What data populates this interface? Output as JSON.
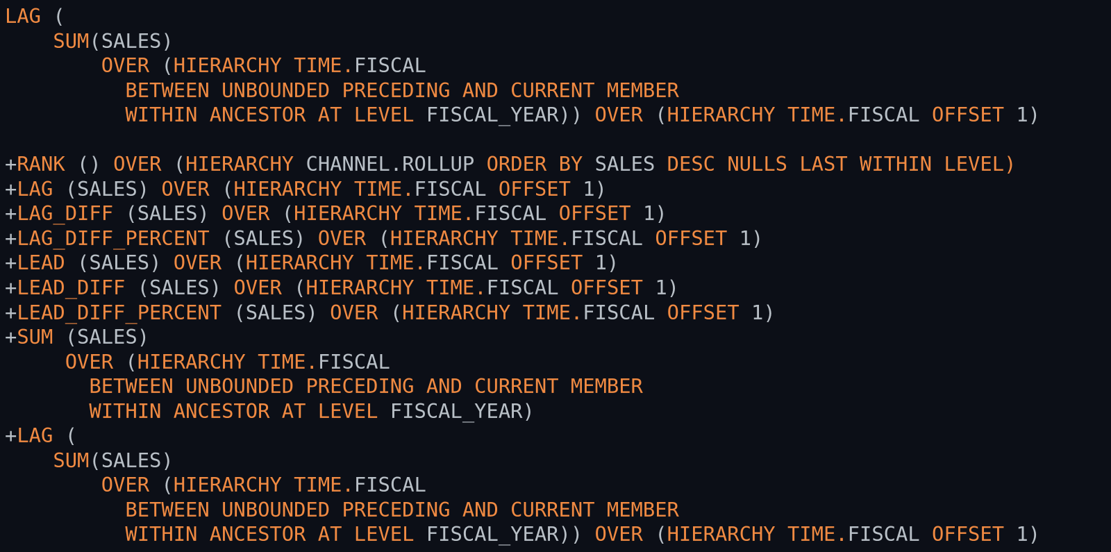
{
  "editor": {
    "name": "sql-analytic-view-expression-viewer",
    "background_color": "#0c0f17",
    "keyword_color": "#f08a42",
    "identifier_color": "#b9c0c7",
    "font_size_px": 28.8,
    "line_height_px": 35.55,
    "total_lines": 22
  },
  "lines": [
    {
      "id": 1,
      "text": "LAG (",
      "tokens": [
        {
          "t": "LAG",
          "c": "kw"
        },
        {
          "t": " ",
          "c": "punc"
        },
        {
          "t": "(",
          "c": "punc"
        }
      ]
    },
    {
      "id": 2,
      "text": "    SUM(SALES)",
      "tokens": [
        {
          "t": "    ",
          "c": "punc"
        },
        {
          "t": "SUM",
          "c": "kw"
        },
        {
          "t": "(SALES)",
          "c": "ident"
        }
      ]
    },
    {
      "id": 3,
      "text": "        OVER (HIERARCHY TIME.FISCAL",
      "tokens": [
        {
          "t": "        ",
          "c": "punc"
        },
        {
          "t": "OVER",
          "c": "kw"
        },
        {
          "t": " ",
          "c": "punc"
        },
        {
          "t": "(",
          "c": "punc"
        },
        {
          "t": "HIERARCHY",
          "c": "kw"
        },
        {
          "t": " ",
          "c": "punc"
        },
        {
          "t": "TIME",
          "c": "kw"
        },
        {
          "t": ".",
          "c": "kw"
        },
        {
          "t": "FISCAL",
          "c": "ident"
        }
      ]
    },
    {
      "id": 4,
      "text": "          BETWEEN UNBOUNDED PRECEDING AND CURRENT MEMBER",
      "tokens": [
        {
          "t": "          ",
          "c": "punc"
        },
        {
          "t": "BETWEEN UNBOUNDED PRECEDING AND CURRENT MEMBER",
          "c": "kw"
        }
      ]
    },
    {
      "id": 5,
      "text": "          WITHIN ANCESTOR AT LEVEL FISCAL_YEAR)) OVER (HIERARCHY TIME.FISCAL OFFSET 1)",
      "tokens": [
        {
          "t": "          ",
          "c": "punc"
        },
        {
          "t": "WITHIN ANCESTOR AT LEVEL",
          "c": "kw"
        },
        {
          "t": " FISCAL_YEAR)) ",
          "c": "ident"
        },
        {
          "t": "OVER",
          "c": "kw"
        },
        {
          "t": " ",
          "c": "punc"
        },
        {
          "t": "(",
          "c": "punc"
        },
        {
          "t": "HIERARCHY",
          "c": "kw"
        },
        {
          "t": " ",
          "c": "punc"
        },
        {
          "t": "TIME",
          "c": "kw"
        },
        {
          "t": ".",
          "c": "kw"
        },
        {
          "t": "FISCAL",
          "c": "ident"
        },
        {
          "t": " ",
          "c": "punc"
        },
        {
          "t": "OFFSET",
          "c": "kw"
        },
        {
          "t": " 1)",
          "c": "ident"
        }
      ]
    },
    {
      "id": 6,
      "text": "",
      "tokens": []
    },
    {
      "id": 7,
      "text": "+RANK () OVER (HIERARCHY CHANNEL.ROLLUP ORDER BY SALES DESC NULLS LAST WITHIN LEVEL)",
      "tokens": [
        {
          "t": "+",
          "c": "plus"
        },
        {
          "t": "RANK",
          "c": "kw"
        },
        {
          "t": " () ",
          "c": "ident"
        },
        {
          "t": "OVER",
          "c": "kw"
        },
        {
          "t": " ",
          "c": "punc"
        },
        {
          "t": "(",
          "c": "punc"
        },
        {
          "t": "HIERARCHY",
          "c": "kw"
        },
        {
          "t": " CHANNEL.ROLLUP ",
          "c": "ident"
        },
        {
          "t": "ORDER BY",
          "c": "kw"
        },
        {
          "t": " SALES ",
          "c": "ident"
        },
        {
          "t": "DESC NULLS LAST WITHIN LEVEL)",
          "c": "kw"
        }
      ]
    },
    {
      "id": 8,
      "text": "+LAG (SALES) OVER (HIERARCHY TIME.FISCAL OFFSET 1)",
      "tokens": [
        {
          "t": "+",
          "c": "plus"
        },
        {
          "t": "LAG",
          "c": "kw"
        },
        {
          "t": " (SALES) ",
          "c": "ident"
        },
        {
          "t": "OVER",
          "c": "kw"
        },
        {
          "t": " ",
          "c": "punc"
        },
        {
          "t": "(",
          "c": "punc"
        },
        {
          "t": "HIERARCHY",
          "c": "kw"
        },
        {
          "t": " ",
          "c": "punc"
        },
        {
          "t": "TIME",
          "c": "kw"
        },
        {
          "t": ".",
          "c": "kw"
        },
        {
          "t": "FISCAL",
          "c": "ident"
        },
        {
          "t": " ",
          "c": "punc"
        },
        {
          "t": "OFFSET",
          "c": "kw"
        },
        {
          "t": " 1)",
          "c": "ident"
        }
      ]
    },
    {
      "id": 9,
      "text": "+LAG_DIFF (SALES) OVER (HIERARCHY TIME.FISCAL OFFSET 1)",
      "tokens": [
        {
          "t": "+",
          "c": "plus"
        },
        {
          "t": "LAG_DIFF",
          "c": "kw"
        },
        {
          "t": " (SALES) ",
          "c": "ident"
        },
        {
          "t": "OVER",
          "c": "kw"
        },
        {
          "t": " ",
          "c": "punc"
        },
        {
          "t": "(",
          "c": "punc"
        },
        {
          "t": "HIERARCHY",
          "c": "kw"
        },
        {
          "t": " ",
          "c": "punc"
        },
        {
          "t": "TIME",
          "c": "kw"
        },
        {
          "t": ".",
          "c": "kw"
        },
        {
          "t": "FISCAL",
          "c": "ident"
        },
        {
          "t": " ",
          "c": "punc"
        },
        {
          "t": "OFFSET",
          "c": "kw"
        },
        {
          "t": " 1)",
          "c": "ident"
        }
      ]
    },
    {
      "id": 10,
      "text": "+LAG_DIFF_PERCENT (SALES) OVER (HIERARCHY TIME.FISCAL OFFSET 1)",
      "tokens": [
        {
          "t": "+",
          "c": "plus"
        },
        {
          "t": "LAG_DIFF_PERCENT",
          "c": "kw"
        },
        {
          "t": " (SALES) ",
          "c": "ident"
        },
        {
          "t": "OVER",
          "c": "kw"
        },
        {
          "t": " ",
          "c": "punc"
        },
        {
          "t": "(",
          "c": "punc"
        },
        {
          "t": "HIERARCHY",
          "c": "kw"
        },
        {
          "t": " ",
          "c": "punc"
        },
        {
          "t": "TIME",
          "c": "kw"
        },
        {
          "t": ".",
          "c": "kw"
        },
        {
          "t": "FISCAL",
          "c": "ident"
        },
        {
          "t": " ",
          "c": "punc"
        },
        {
          "t": "OFFSET",
          "c": "kw"
        },
        {
          "t": " 1)",
          "c": "ident"
        }
      ]
    },
    {
      "id": 11,
      "text": "+LEAD (SALES) OVER (HIERARCHY TIME.FISCAL OFFSET 1)",
      "tokens": [
        {
          "t": "+",
          "c": "plus"
        },
        {
          "t": "LEAD",
          "c": "kw"
        },
        {
          "t": " (SALES) ",
          "c": "ident"
        },
        {
          "t": "OVER",
          "c": "kw"
        },
        {
          "t": " ",
          "c": "punc"
        },
        {
          "t": "(",
          "c": "punc"
        },
        {
          "t": "HIERARCHY",
          "c": "kw"
        },
        {
          "t": " ",
          "c": "punc"
        },
        {
          "t": "TIME",
          "c": "kw"
        },
        {
          "t": ".",
          "c": "kw"
        },
        {
          "t": "FISCAL",
          "c": "ident"
        },
        {
          "t": " ",
          "c": "punc"
        },
        {
          "t": "OFFSET",
          "c": "kw"
        },
        {
          "t": " 1)",
          "c": "ident"
        }
      ]
    },
    {
      "id": 12,
      "text": "+LEAD_DIFF (SALES) OVER (HIERARCHY TIME.FISCAL OFFSET 1)",
      "tokens": [
        {
          "t": "+",
          "c": "plus"
        },
        {
          "t": "LEAD_DIFF",
          "c": "kw"
        },
        {
          "t": " (SALES) ",
          "c": "ident"
        },
        {
          "t": "OVER",
          "c": "kw"
        },
        {
          "t": " ",
          "c": "punc"
        },
        {
          "t": "(",
          "c": "punc"
        },
        {
          "t": "HIERARCHY",
          "c": "kw"
        },
        {
          "t": " ",
          "c": "punc"
        },
        {
          "t": "TIME",
          "c": "kw"
        },
        {
          "t": ".",
          "c": "kw"
        },
        {
          "t": "FISCAL",
          "c": "ident"
        },
        {
          "t": " ",
          "c": "punc"
        },
        {
          "t": "OFFSET",
          "c": "kw"
        },
        {
          "t": " 1)",
          "c": "ident"
        }
      ]
    },
    {
      "id": 13,
      "text": "+LEAD_DIFF_PERCENT (SALES) OVER (HIERARCHY TIME.FISCAL OFFSET 1)",
      "tokens": [
        {
          "t": "+",
          "c": "plus"
        },
        {
          "t": "LEAD_DIFF_PERCENT",
          "c": "kw"
        },
        {
          "t": " (SALES) ",
          "c": "ident"
        },
        {
          "t": "OVER",
          "c": "kw"
        },
        {
          "t": " ",
          "c": "punc"
        },
        {
          "t": "(",
          "c": "punc"
        },
        {
          "t": "HIERARCHY",
          "c": "kw"
        },
        {
          "t": " ",
          "c": "punc"
        },
        {
          "t": "TIME",
          "c": "kw"
        },
        {
          "t": ".",
          "c": "kw"
        },
        {
          "t": "FISCAL",
          "c": "ident"
        },
        {
          "t": " ",
          "c": "punc"
        },
        {
          "t": "OFFSET",
          "c": "kw"
        },
        {
          "t": " 1)",
          "c": "ident"
        }
      ]
    },
    {
      "id": 14,
      "text": "+SUM (SALES)",
      "tokens": [
        {
          "t": "+",
          "c": "plus"
        },
        {
          "t": "SUM",
          "c": "kw"
        },
        {
          "t": " (SALES)",
          "c": "ident"
        }
      ]
    },
    {
      "id": 15,
      "text": "     OVER (HIERARCHY TIME.FISCAL",
      "tokens": [
        {
          "t": "     ",
          "c": "punc"
        },
        {
          "t": "OVER",
          "c": "kw"
        },
        {
          "t": " ",
          "c": "punc"
        },
        {
          "t": "(",
          "c": "punc"
        },
        {
          "t": "HIERARCHY",
          "c": "kw"
        },
        {
          "t": " ",
          "c": "punc"
        },
        {
          "t": "TIME",
          "c": "kw"
        },
        {
          "t": ".",
          "c": "kw"
        },
        {
          "t": "FISCAL",
          "c": "ident"
        }
      ]
    },
    {
      "id": 16,
      "text": "       BETWEEN UNBOUNDED PRECEDING AND CURRENT MEMBER",
      "tokens": [
        {
          "t": "       ",
          "c": "punc"
        },
        {
          "t": "BETWEEN UNBOUNDED PRECEDING AND CURRENT MEMBER",
          "c": "kw"
        }
      ]
    },
    {
      "id": 17,
      "text": "       WITHIN ANCESTOR AT LEVEL FISCAL_YEAR)",
      "tokens": [
        {
          "t": "       ",
          "c": "punc"
        },
        {
          "t": "WITHIN ANCESTOR AT LEVEL",
          "c": "kw"
        },
        {
          "t": " FISCAL_YEAR)",
          "c": "ident"
        }
      ]
    },
    {
      "id": 18,
      "text": "+LAG (",
      "tokens": [
        {
          "t": "+",
          "c": "plus"
        },
        {
          "t": "LAG",
          "c": "kw"
        },
        {
          "t": " (",
          "c": "ident"
        }
      ]
    },
    {
      "id": 19,
      "text": "    SUM(SALES)",
      "tokens": [
        {
          "t": "    ",
          "c": "punc"
        },
        {
          "t": "SUM",
          "c": "kw"
        },
        {
          "t": "(SALES)",
          "c": "ident"
        }
      ]
    },
    {
      "id": 20,
      "text": "        OVER (HIERARCHY TIME.FISCAL",
      "tokens": [
        {
          "t": "        ",
          "c": "punc"
        },
        {
          "t": "OVER",
          "c": "kw"
        },
        {
          "t": " ",
          "c": "punc"
        },
        {
          "t": "(",
          "c": "punc"
        },
        {
          "t": "HIERARCHY",
          "c": "kw"
        },
        {
          "t": " ",
          "c": "punc"
        },
        {
          "t": "TIME",
          "c": "kw"
        },
        {
          "t": ".",
          "c": "kw"
        },
        {
          "t": "FISCAL",
          "c": "ident"
        }
      ]
    },
    {
      "id": 21,
      "text": "          BETWEEN UNBOUNDED PRECEDING AND CURRENT MEMBER",
      "tokens": [
        {
          "t": "          ",
          "c": "punc"
        },
        {
          "t": "BETWEEN UNBOUNDED PRECEDING AND CURRENT MEMBER",
          "c": "kw"
        }
      ]
    },
    {
      "id": 22,
      "text": "          WITHIN ANCESTOR AT LEVEL FISCAL_YEAR)) OVER (HIERARCHY TIME.FISCAL OFFSET 1)",
      "tokens": [
        {
          "t": "          ",
          "c": "punc"
        },
        {
          "t": "WITHIN ANCESTOR AT LEVEL",
          "c": "kw"
        },
        {
          "t": " FISCAL_YEAR)) ",
          "c": "ident"
        },
        {
          "t": "OVER",
          "c": "kw"
        },
        {
          "t": " ",
          "c": "punc"
        },
        {
          "t": "(",
          "c": "punc"
        },
        {
          "t": "HIERARCHY",
          "c": "kw"
        },
        {
          "t": " ",
          "c": "punc"
        },
        {
          "t": "TIME",
          "c": "kw"
        },
        {
          "t": ".",
          "c": "kw"
        },
        {
          "t": "FISCAL",
          "c": "ident"
        },
        {
          "t": " ",
          "c": "punc"
        },
        {
          "t": "OFFSET",
          "c": "kw"
        },
        {
          "t": " 1)",
          "c": "ident"
        }
      ]
    }
  ]
}
